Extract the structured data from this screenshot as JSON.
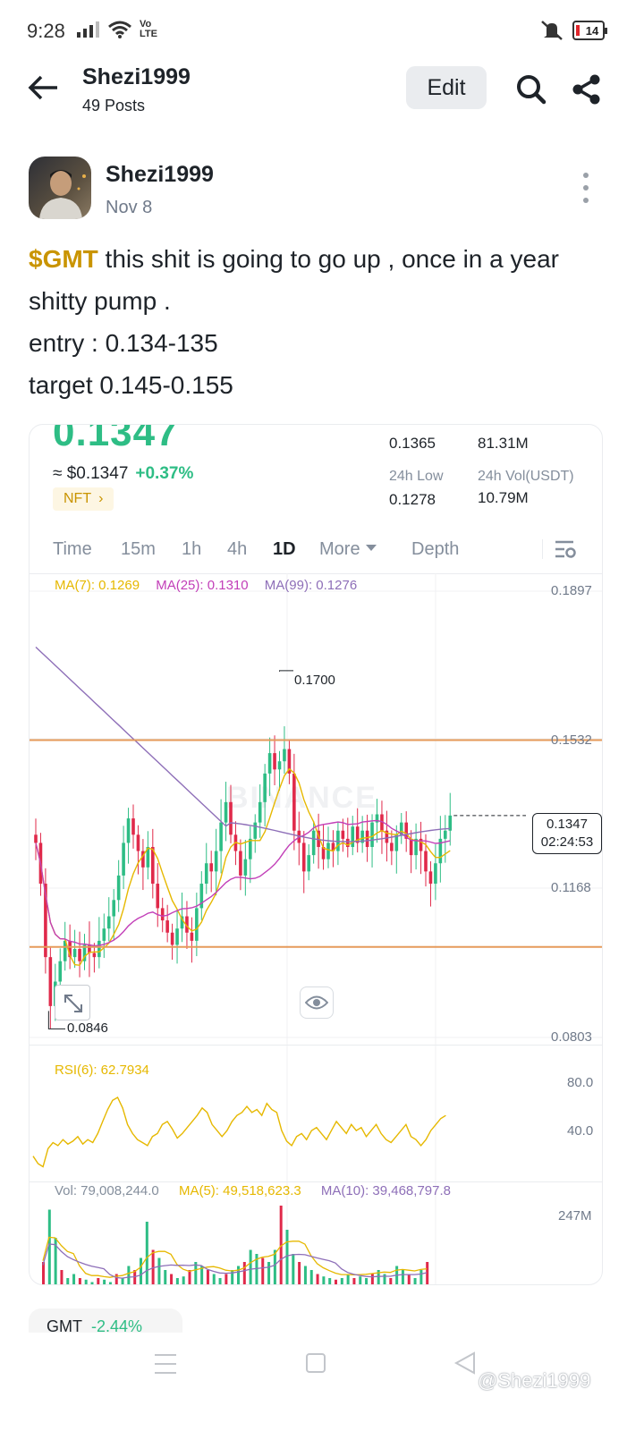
{
  "status_bar": {
    "time": "9:28",
    "network": "Vo LTE",
    "battery": "14"
  },
  "header": {
    "name": "Shezi1999",
    "posts": "49 Posts",
    "edit_label": "Edit",
    "icons": [
      "back-arrow-icon",
      "search-icon",
      "share-icon"
    ]
  },
  "post": {
    "author": "Shezi1999",
    "date": "Nov 8",
    "ticker": "$GMT",
    "line1": " this shit is going to go up , once in a year shitty pump .",
    "line2": "entry : 0.134-135",
    "line3": "target 0.145-0.155"
  },
  "chart_card": {
    "price": "0.1347",
    "usd_price": "≈ $0.1347",
    "change": "+0.37%",
    "tag": "NFT",
    "stats": {
      "high_value": "0.1365",
      "vol_value": "81.31M",
      "low_label": "24h Low",
      "low_value": "0.1278",
      "vol_usdt_label": "24h Vol(USDT)",
      "vol_usdt_value": "10.79M"
    },
    "tabs": [
      "Time",
      "15m",
      "1h",
      "4h",
      "1D",
      "More",
      "Depth"
    ],
    "active_tab": "1D",
    "ma_legend": {
      "ma7": "MA(7): 0.1269",
      "ma25": "MA(25): 0.1310",
      "ma99": "MA(99): 0.1276"
    },
    "y_axis": [
      "0.1897",
      "0.1532",
      "0.1168",
      "0.0803"
    ],
    "high_marker": "0.1700",
    "low_marker": "0.0846",
    "current_price_tag": "0.1347",
    "countdown": "02:24:53",
    "watermark": "BINANCE",
    "rsi_legend": "RSI(6): 62.7934",
    "rsi_axis": [
      "80.0",
      "40.0"
    ],
    "vol_legend": {
      "vol": "Vol: 79,008,244.0",
      "ma5": "MA(5): 49,518,623.3",
      "ma10": "MA(10): 39,468,797.8"
    },
    "vol_axis": "247M",
    "colors": {
      "up": "#2ebd85",
      "down": "#e0294a",
      "ma7": "#e6b800",
      "ma25": "#c23fb8",
      "ma99": "#8e6fb8",
      "hline": "#e59a5a"
    }
  },
  "chart_data": {
    "type": "candlestick",
    "y_range": [
      0.0803,
      0.1897
    ],
    "horizontal_lines": [
      0.1532,
      0.1025
    ],
    "closes": [
      0.128,
      0.118,
      0.1,
      0.088,
      0.094,
      0.099,
      0.104,
      0.1,
      0.102,
      0.099,
      0.103,
      0.101,
      0.1,
      0.104,
      0.107,
      0.11,
      0.114,
      0.12,
      0.128,
      0.134,
      0.13,
      0.126,
      0.122,
      0.127,
      0.118,
      0.112,
      0.109,
      0.106,
      0.103,
      0.107,
      0.11,
      0.106,
      0.104,
      0.112,
      0.118,
      0.123,
      0.121,
      0.126,
      0.133,
      0.138,
      0.13,
      0.126,
      0.12,
      0.124,
      0.129,
      0.133,
      0.138,
      0.145,
      0.15,
      0.146,
      0.148,
      0.151,
      0.145,
      0.131,
      0.128,
      0.121,
      0.125,
      0.131,
      0.127,
      0.124,
      0.128,
      0.126,
      0.131,
      0.129,
      0.127,
      0.132,
      0.128,
      0.131,
      0.127,
      0.133,
      0.135,
      0.131,
      0.128,
      0.126,
      0.13,
      0.133,
      0.129,
      0.125,
      0.129,
      0.126,
      0.121,
      0.118,
      0.123,
      0.129,
      0.131,
      0.1347
    ],
    "rsi": [
      35,
      30,
      28,
      40,
      44,
      42,
      46,
      43,
      45,
      48,
      43,
      46,
      44,
      50,
      58,
      66,
      72,
      74,
      67,
      56,
      50,
      46,
      44,
      42,
      48,
      50,
      56,
      58,
      53,
      47,
      50,
      54,
      58,
      62,
      67,
      64,
      56,
      52,
      48,
      52,
      58,
      62,
      64,
      68,
      64,
      66,
      62,
      70,
      66,
      64,
      52,
      45,
      42,
      48,
      50,
      46,
      52,
      54,
      50,
      46,
      52,
      58,
      54,
      50,
      56,
      52,
      54,
      48,
      52,
      56,
      50,
      46,
      44,
      48,
      52,
      56,
      48,
      46,
      42,
      46,
      52,
      56,
      60,
      62
    ],
    "volume": [
      0.3,
      0.95,
      0.6,
      0.2,
      0.1,
      0.15,
      0.1,
      0.08,
      0.05,
      0.1,
      0.08,
      0.05,
      0.15,
      0.1,
      0.25,
      0.2,
      0.35,
      0.8,
      0.45,
      0.35,
      0.2,
      0.15,
      0.1,
      0.12,
      0.2,
      0.3,
      0.25,
      0.2,
      0.15,
      0.1,
      0.15,
      0.2,
      0.25,
      0.3,
      0.45,
      0.4,
      0.35,
      0.3,
      0.45,
      1.0,
      0.7,
      0.4,
      0.3,
      0.25,
      0.2,
      0.15,
      0.12,
      0.1,
      0.08,
      0.1,
      0.15,
      0.1,
      0.12,
      0.1,
      0.15,
      0.2,
      0.15,
      0.1,
      0.25,
      0.2,
      0.15,
      0.1,
      0.2,
      0.3
    ]
  },
  "below": {
    "ticker": "GMT",
    "change": "-2.44%"
  },
  "credit": "@Shezi1999"
}
